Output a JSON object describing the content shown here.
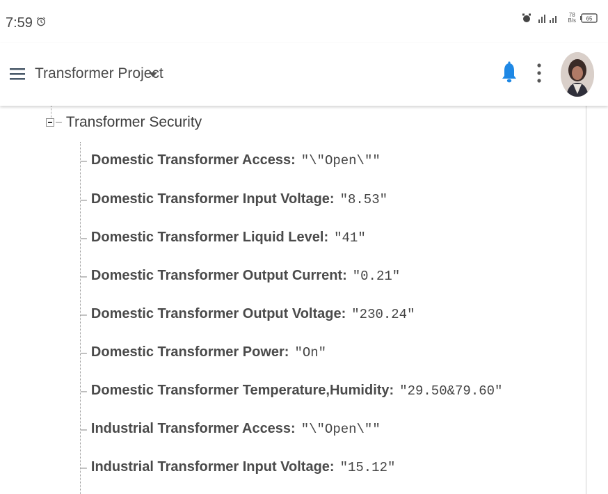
{
  "status_bar": {
    "time": "7:59",
    "speed_value": "78",
    "speed_unit": "B/s",
    "battery": "65"
  },
  "app_bar": {
    "title": "Transformer Project"
  },
  "tree": {
    "root_label": "Transformer Security",
    "items": [
      {
        "key": "Domestic Transformer Access:",
        "value": "\"\\\"Open\\\"\""
      },
      {
        "key": "Domestic Transformer Input Voltage:",
        "value": "\"8.53\""
      },
      {
        "key": "Domestic Transformer Liquid Level:",
        "value": "\"41\""
      },
      {
        "key": "Domestic Transformer Output Current:",
        "value": "\"0.21\""
      },
      {
        "key": "Domestic Transformer Output Voltage:",
        "value": "\"230.24\""
      },
      {
        "key": "Domestic Transformer Power:",
        "value": "\"On\""
      },
      {
        "key": "Domestic Transformer Temperature,Humidity:",
        "value": "\"29.50&79.60\""
      },
      {
        "key": "Industrial Transformer Access:",
        "value": "\"\\\"Open\\\"\""
      },
      {
        "key": "Industrial Transformer Input Voltage:",
        "value": "\"15.12\""
      }
    ]
  },
  "icons": {
    "alarm": "alarm-clock-icon",
    "menu": "hamburger-menu-icon",
    "caret": "caret-down-icon",
    "bell": "bell-icon",
    "more": "more-vertical-icon"
  },
  "colors": {
    "bell": "#1e88e5",
    "text": "#3a3a3a"
  }
}
